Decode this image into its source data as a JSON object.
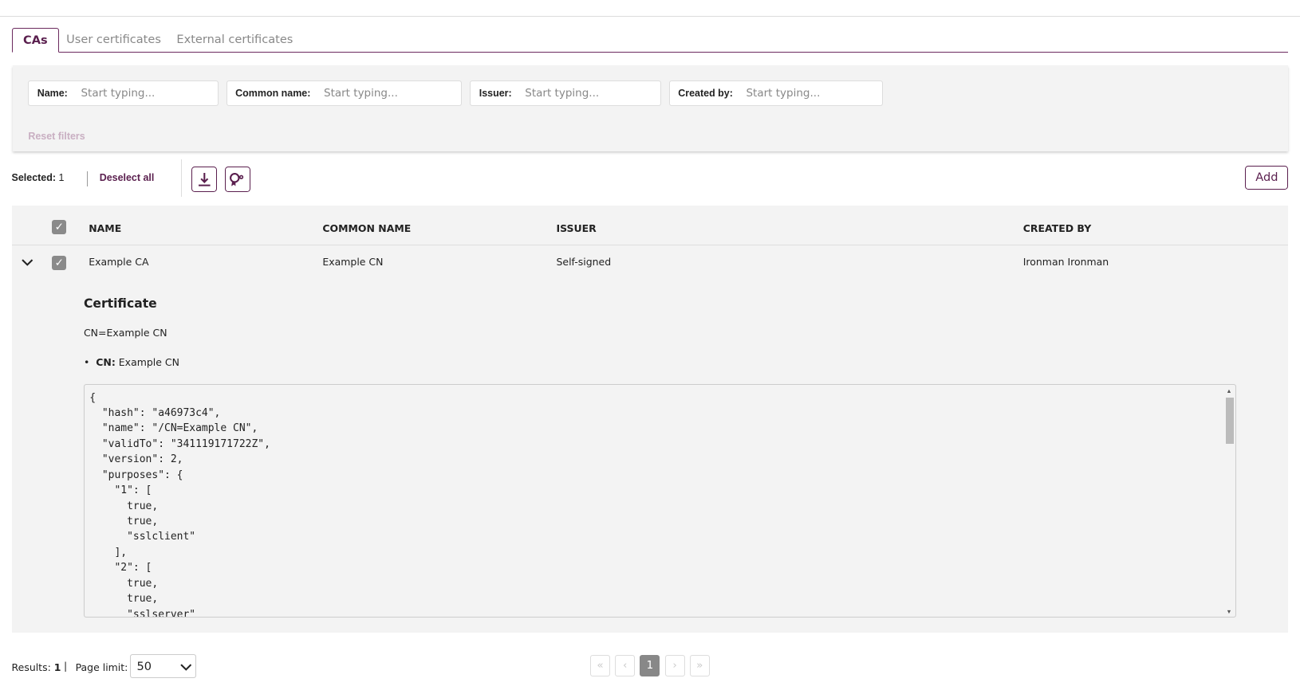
{
  "tabs": [
    {
      "label": "CAs",
      "active": true
    },
    {
      "label": "User certificates"
    },
    {
      "label": "External certificates"
    }
  ],
  "filters": {
    "fields": [
      {
        "label": "Name:",
        "placeholder": "Start typing...",
        "value": ""
      },
      {
        "label": "Common name:",
        "placeholder": "Start typing...",
        "value": ""
      },
      {
        "label": "Issuer:",
        "placeholder": "Start typing...",
        "value": ""
      },
      {
        "label": "Created by:",
        "placeholder": "Start typing...",
        "value": ""
      }
    ],
    "reset_label": "Reset filters"
  },
  "toolbar": {
    "selected_label": "Selected:",
    "selected_count": "1",
    "deselect_label": "Deselect all",
    "download_icon": "download-icon",
    "settings_icon": "certificate-settings-icon",
    "add_label": "Add"
  },
  "table": {
    "columns": [
      "NAME",
      "COMMON NAME",
      "ISSUER",
      "CREATED BY"
    ],
    "rows": [
      {
        "name": "Example CA",
        "common_name": "Example CN",
        "issuer": "Self-signed",
        "created_by": "Ironman Ironman",
        "selected": true,
        "expanded": true
      }
    ]
  },
  "detail": {
    "title": "Certificate",
    "dn": "CN=Example CN",
    "bullet_key": "CN:",
    "bullet_value": " Example CN",
    "json": "{\n  \"hash\": \"a46973c4\",\n  \"name\": \"/CN=Example CN\",\n  \"validTo\": \"341119171722Z\",\n  \"version\": 2,\n  \"purposes\": {\n    \"1\": [\n      true,\n      true,\n      \"sslclient\"\n    ],\n    \"2\": [\n      true,\n      true,\n      \"sslserver\""
  },
  "footer": {
    "results_label": "Results:",
    "results_count": "1",
    "page_limit_label": "Page limit:",
    "page_limit": "50",
    "pages": [
      "«",
      "‹",
      "1",
      "›",
      "»"
    ],
    "current_page": "1"
  },
  "colors": {
    "accent": "#5a1f4e",
    "panel": "#f3f3f3"
  }
}
